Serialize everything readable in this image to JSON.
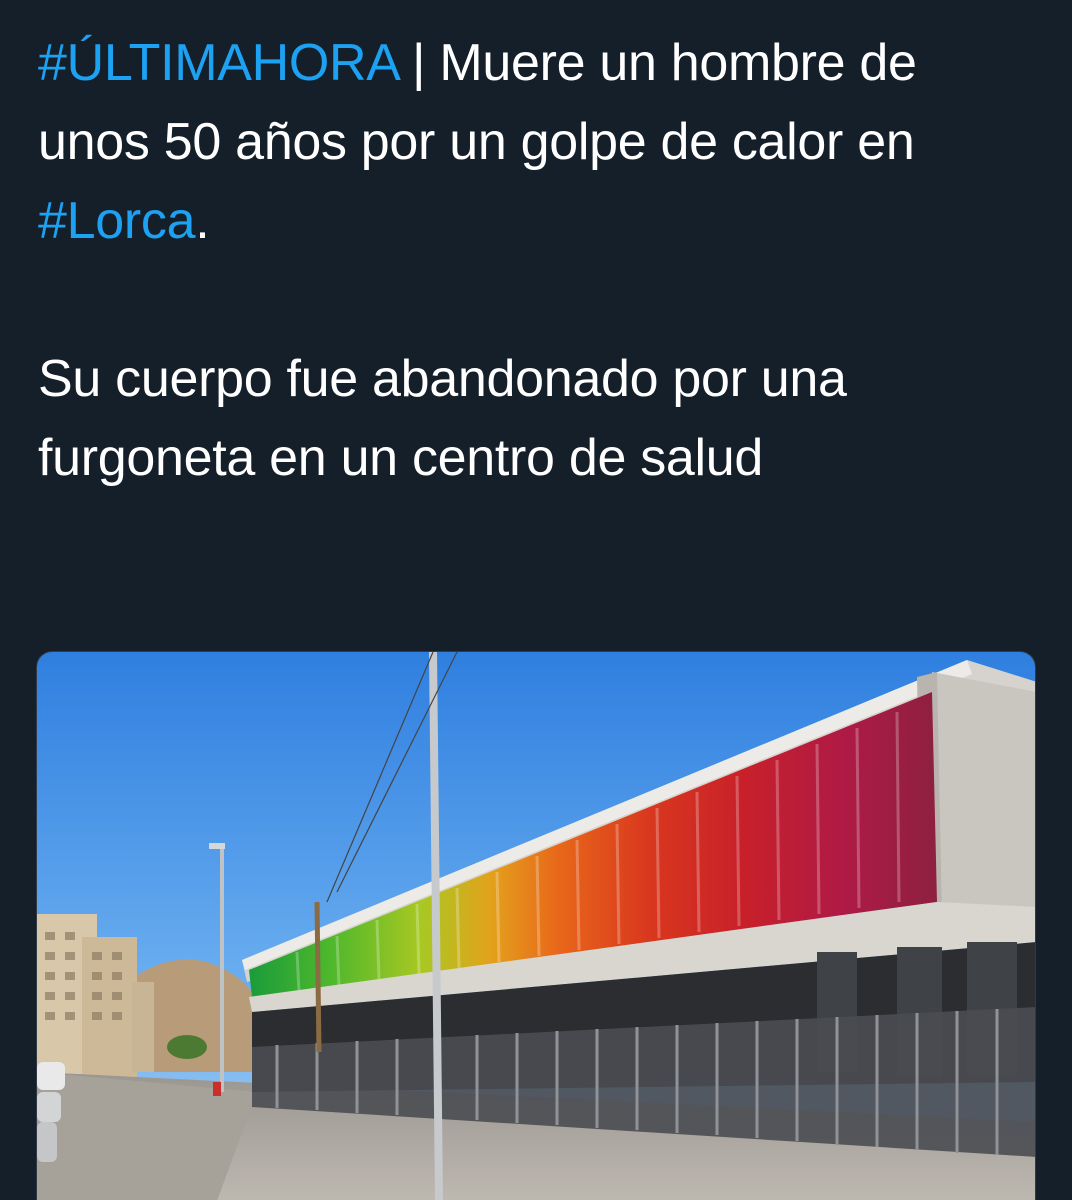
{
  "tweet": {
    "line1": {
      "hashtag": "#ÚLTIMAHORA",
      "separator": " | ",
      "text": "Muere un hombre de unos 50 años por un golpe de calor en "
    },
    "line1_hashtag2": "#Lorca",
    "line1_end": ".",
    "paragraph2": "Su cuerpo fue abandonado por una furgoneta en un centro de salud"
  },
  "media": {
    "icon": "photo-attachment",
    "description_hidden": ""
  },
  "colors": {
    "background": "#151f2a",
    "text": "#ffffff",
    "hashtag": "#1da1f2"
  }
}
